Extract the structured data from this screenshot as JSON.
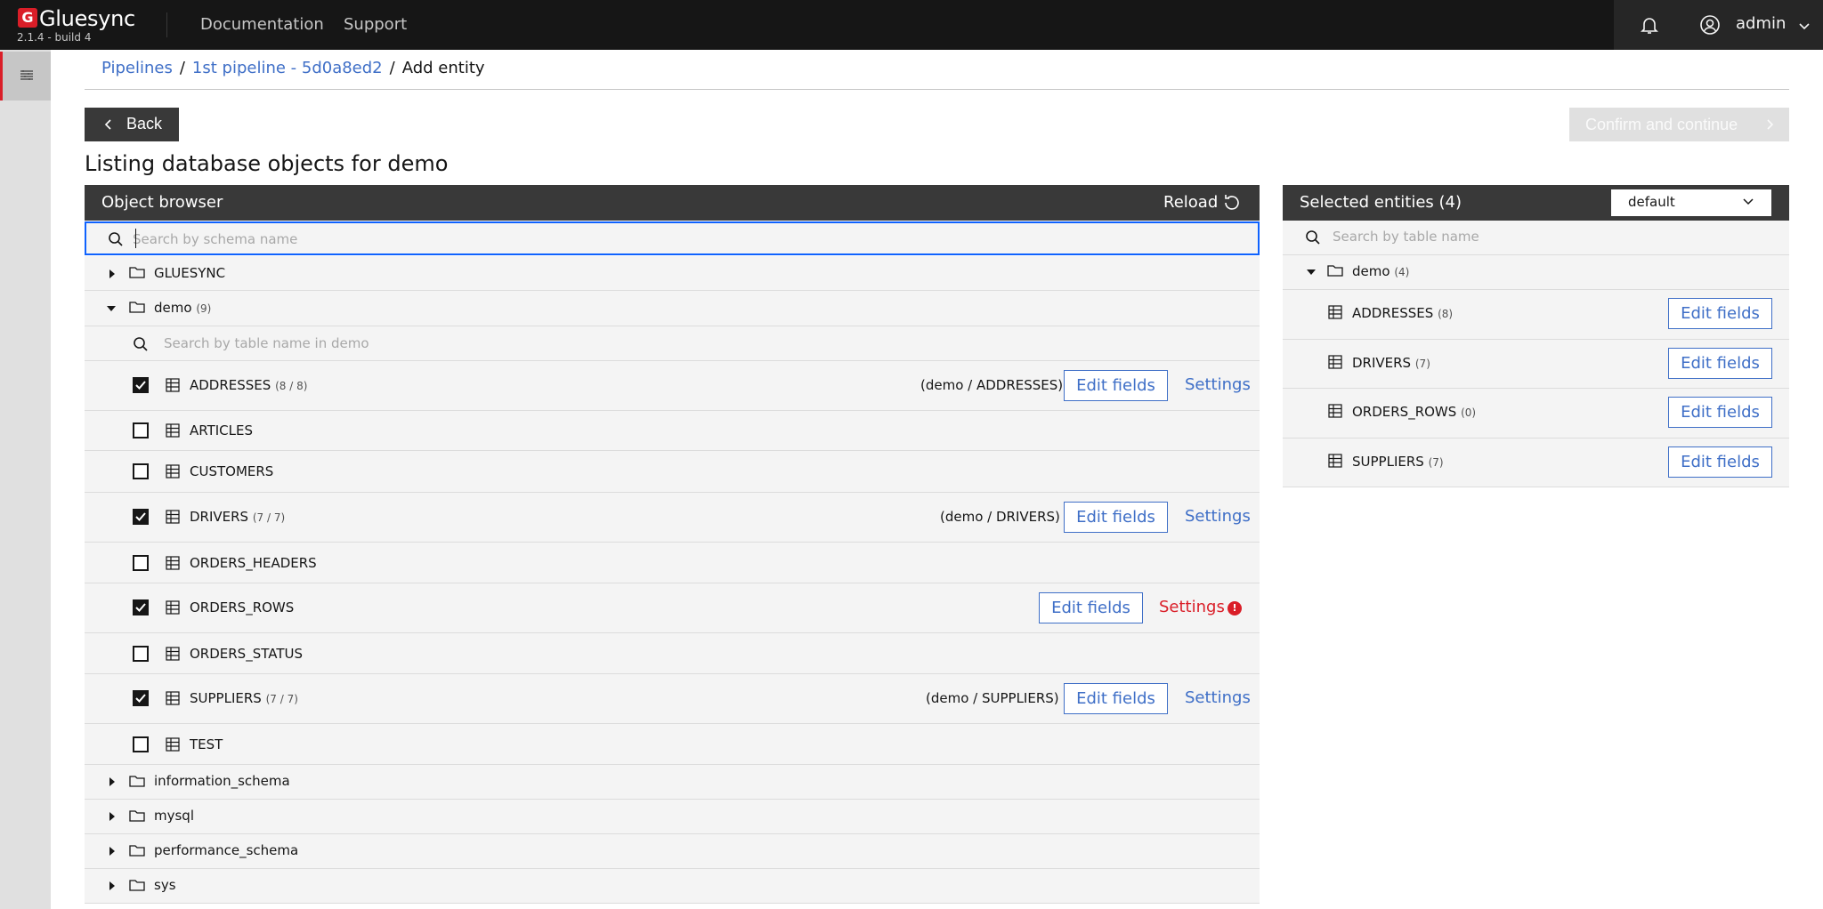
{
  "header": {
    "brand": "Gluesync",
    "brand_mark": "G",
    "version": "2.1.4 - build 4",
    "nav": [
      "Documentation",
      "Support"
    ],
    "user": "admin"
  },
  "breadcrumb": {
    "items": [
      "Pipelines",
      "1st pipeline - 5d0a8ed2"
    ],
    "current": "Add entity"
  },
  "actions": {
    "back": "Back",
    "confirm": "Confirm and continue"
  },
  "heading": {
    "prefix": "Listing database objects for",
    "db": "demo"
  },
  "object_browser": {
    "title": "Object browser",
    "reload": "Reload",
    "search_placeholder": "Search by schema name",
    "table_search_placeholder": "Search by table name in demo",
    "schemas_top": [
      {
        "name": "GLUESYNC",
        "expanded": false
      }
    ],
    "demo": {
      "name": "demo",
      "count": "(9)",
      "expanded": true
    },
    "tables": [
      {
        "name": "ADDRESSES",
        "count": "(8 / 8)",
        "checked": true,
        "path": "(demo / ADDRESSES)",
        "edit": "Edit fields",
        "settings": "Settings",
        "error": false
      },
      {
        "name": "ARTICLES",
        "count": "",
        "checked": false
      },
      {
        "name": "CUSTOMERS",
        "count": "",
        "checked": false
      },
      {
        "name": "DRIVERS",
        "count": "(7 / 7)",
        "checked": true,
        "path": "(demo / DRIVERS)",
        "edit": "Edit fields",
        "settings": "Settings",
        "error": false
      },
      {
        "name": "ORDERS_HEADERS",
        "count": "",
        "checked": false
      },
      {
        "name": "ORDERS_ROWS",
        "count": "",
        "checked": true,
        "path": "",
        "edit": "Edit fields",
        "settings": "Settings",
        "error": true,
        "error_mark": "!"
      },
      {
        "name": "ORDERS_STATUS",
        "count": "",
        "checked": false
      },
      {
        "name": "SUPPLIERS",
        "count": "(7 / 7)",
        "checked": true,
        "path": "(demo / SUPPLIERS)",
        "edit": "Edit fields",
        "settings": "Settings",
        "error": false
      },
      {
        "name": "TEST",
        "count": "",
        "checked": false
      }
    ],
    "schemas_bottom": [
      {
        "name": "information_schema"
      },
      {
        "name": "mysql"
      },
      {
        "name": "performance_schema"
      },
      {
        "name": "sys"
      }
    ]
  },
  "selected": {
    "title": "Selected entities (4)",
    "dropdown_value": "default",
    "search_placeholder": "Search by table name",
    "schema": {
      "name": "demo",
      "count": "(4)"
    },
    "entities": [
      {
        "name": "ADDRESSES",
        "count": "(8)",
        "edit": "Edit fields"
      },
      {
        "name": "DRIVERS",
        "count": "(7)",
        "edit": "Edit fields"
      },
      {
        "name": "ORDERS_ROWS",
        "count": "(0)",
        "edit": "Edit fields"
      },
      {
        "name": "SUPPLIERS",
        "count": "(7)",
        "edit": "Edit fields"
      }
    ]
  },
  "colors": {
    "header_bg": "#161616",
    "accent_red": "#da1e28",
    "link_blue": "#3f6fc7",
    "focus_blue": "#0f62fe"
  }
}
